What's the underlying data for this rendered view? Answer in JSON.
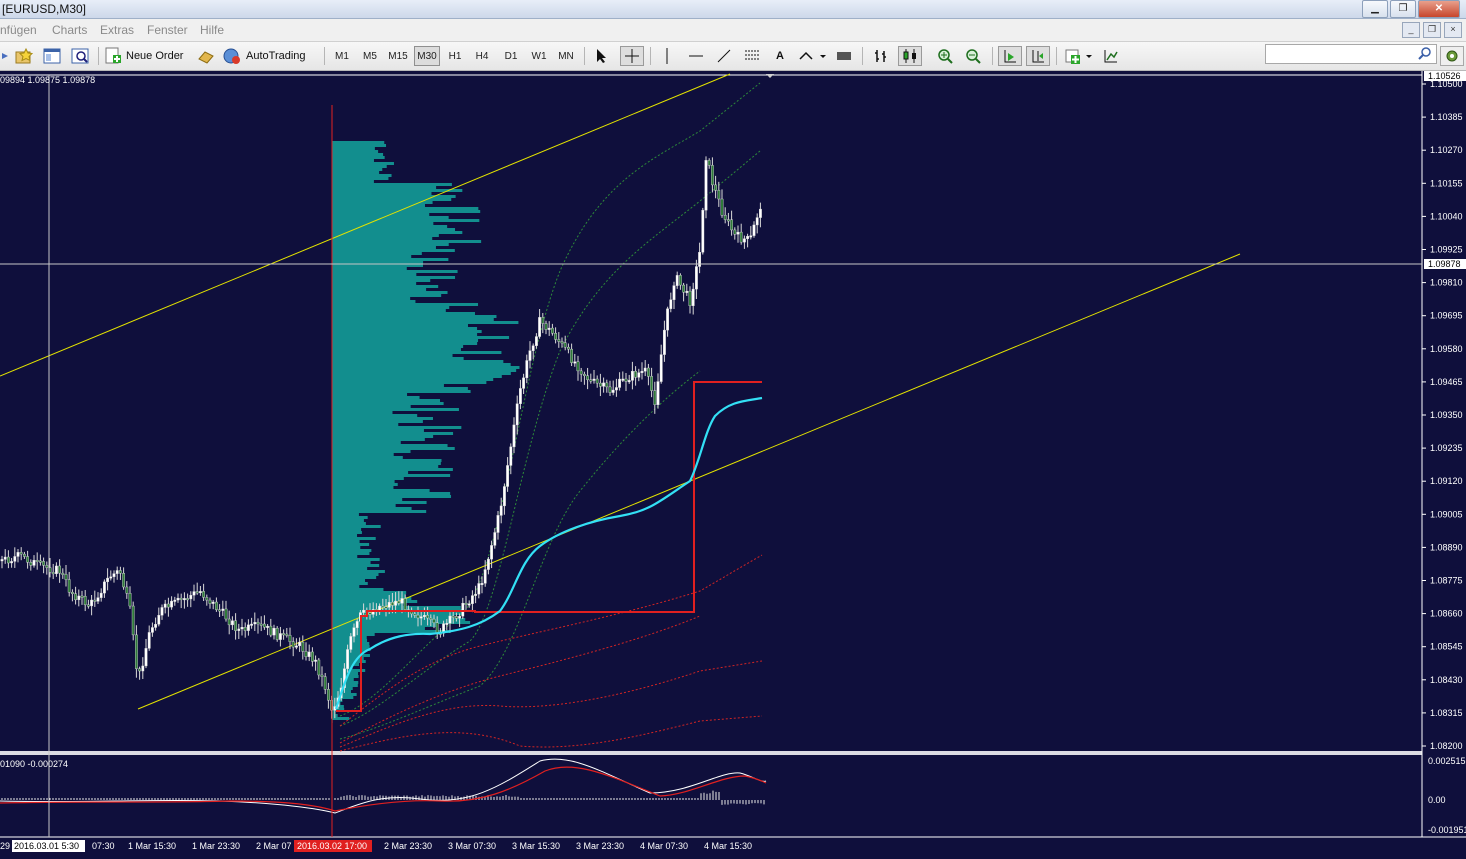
{
  "window": {
    "title": "[EURUSD,M30]"
  },
  "menu": {
    "items": [
      "nfügen",
      "Charts",
      "Extras",
      "Fenster",
      "Hilfe"
    ]
  },
  "toolbar": {
    "new_order": "Neue Order",
    "autotrading": "AutoTrading",
    "timeframes": [
      "M1",
      "M5",
      "M15",
      "M30",
      "H1",
      "H4",
      "D1",
      "W1",
      "MN"
    ],
    "active_timeframe": "M30"
  },
  "chart": {
    "info": "09894 1.09875 1.09878",
    "indicator_info": "01090 -0.000274",
    "price_labels": [
      "1.10500",
      "1.10385",
      "1.10270",
      "1.10155",
      "1.10040",
      "1.09925",
      "1.09810",
      "1.09695",
      "1.09580",
      "1.09465",
      "1.09350",
      "1.09235",
      "1.09120",
      "1.09005",
      "1.08890",
      "1.08775",
      "1.08660",
      "1.08545",
      "1.08430",
      "1.08315",
      "1.08200"
    ],
    "top_price": "1.10526",
    "current_price": "1.09878",
    "indicator_labels": [
      "0.002515",
      "0.00",
      "-0.001951"
    ],
    "time_labels": [
      "29",
      "2016.03.01 5:30",
      "07:30",
      "1 Mar 15:30",
      "1 Mar 23:30",
      "2 Mar 07",
      "2016.03.02 17:00",
      "2 Mar 23:30",
      "3 Mar 07:30",
      "3 Mar 15:30",
      "3 Mar 23:30",
      "4 Mar 07:30",
      "4 Mar 15:30"
    ],
    "colors": {
      "background": "#0f0f3c",
      "profile": "#128e8e",
      "channel": "#e3e300",
      "vwap": "#33e0f5",
      "poc": "#e02020",
      "crosshair": "#c7c7c7",
      "grid": "#ffffff"
    }
  }
}
